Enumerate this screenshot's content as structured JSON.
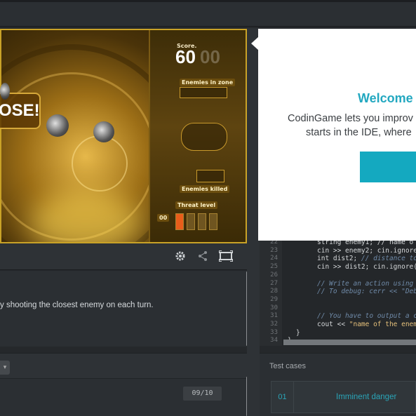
{
  "game": {
    "lose_text": "OSE!",
    "score_label": "Score.",
    "score_value": "60",
    "score_ghost": "00",
    "enemies_in_zone_label": "Enemies in zone",
    "enemies_killed_label": "Enemies killed",
    "threat_level_label": "Threat level",
    "threat_value": "00",
    "threat_level_fraction": 0.25
  },
  "viewer_toolbar": {
    "settings_icon": "gear-icon",
    "share_icon": "share-icon",
    "fullscreen_icon": "fullscreen-icon"
  },
  "statement": {
    "text": "y shooting the closest enemy on each turn."
  },
  "console": {
    "counter": "09/10"
  },
  "editor": {
    "lines": [
      {
        "n": "22",
        "code": "string enemy1; // name o"
      },
      {
        "n": "23",
        "code": "cin >> enemy2; cin.ignore"
      },
      {
        "n": "24",
        "code": "int dist2; ",
        "comment": "// distance to"
      },
      {
        "n": "25",
        "code": "cin >> dist2; cin.ignore("
      },
      {
        "n": "26",
        "code": ""
      },
      {
        "n": "27",
        "code": "",
        "comment": "// Write an action using"
      },
      {
        "n": "28",
        "code": "",
        "comment": "// To debug: cerr << \"Deb"
      },
      {
        "n": "29",
        "code": ""
      },
      {
        "n": "30",
        "code": ""
      },
      {
        "n": "31",
        "code": "",
        "comment": "// You have to output a c"
      },
      {
        "n": "32",
        "code": "cout << ",
        "string": "\"name of the enem"
      },
      {
        "n": "33",
        "code": "}"
      },
      {
        "n": "34",
        "code": "}"
      }
    ]
  },
  "tests": {
    "title": "Test cases",
    "items": [
      {
        "num": "01",
        "name": "Imminent danger"
      }
    ]
  },
  "modal": {
    "title": "Welcome",
    "line1": "CodinGame lets you improv",
    "line2": "starts in the IDE, where"
  }
}
